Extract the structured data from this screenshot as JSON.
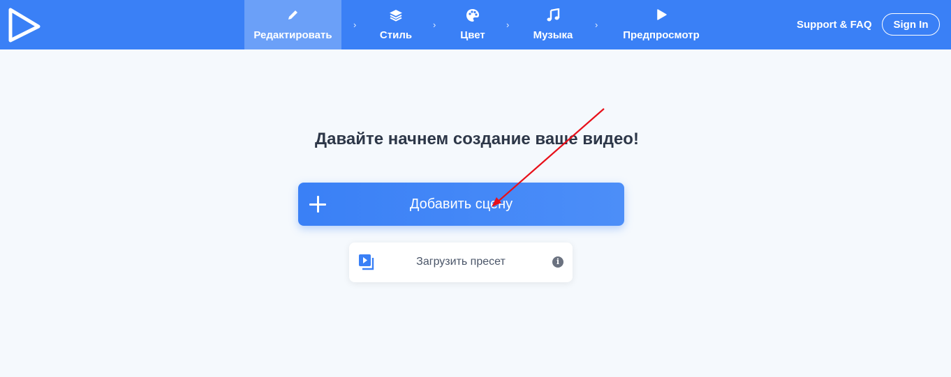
{
  "header": {
    "steps": [
      {
        "label": "Редактировать",
        "icon": "pencil-icon"
      },
      {
        "label": "Стиль",
        "icon": "layers-icon"
      },
      {
        "label": "Цвет",
        "icon": "palette-icon"
      },
      {
        "label": "Музыка",
        "icon": "music-note-icon"
      },
      {
        "label": "Предпросмотр",
        "icon": "play-icon"
      }
    ],
    "active_step": "Редактировать",
    "support_label": "Support & FAQ",
    "signin_label": "Sign In"
  },
  "main": {
    "heading": "Давайте начнем создание ваше видео!",
    "add_scene_label": "Добавить сцену",
    "upload_preset_label": "Загрузить пресет",
    "info_glyph": "i"
  },
  "colors": {
    "brand": "#3a80f6",
    "background": "#f5f9fd",
    "annotation_arrow": "#e8101a"
  }
}
